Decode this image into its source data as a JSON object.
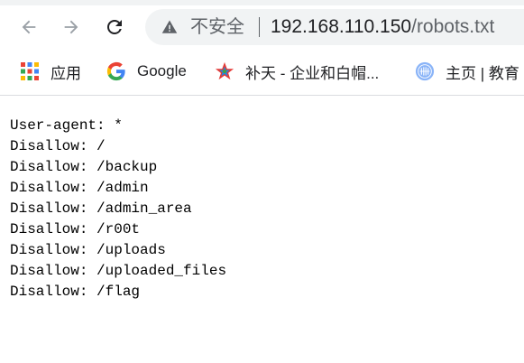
{
  "address_bar": {
    "security_label": "不安全",
    "url_host": "192.168.110.150",
    "url_path": "/robots.txt"
  },
  "bookmarks": [
    {
      "label": "应用",
      "icon": "apps-grid-icon"
    },
    {
      "label": "Google",
      "icon": "google-icon"
    },
    {
      "label": "补天 - 企业和白帽...",
      "icon": "butian-star-icon"
    },
    {
      "label": "主页 | 教育",
      "icon": "globe-icon"
    }
  ],
  "document": {
    "lines": [
      "User-agent: *",
      "Disallow: /",
      "Disallow: /backup",
      "Disallow: /admin",
      "Disallow: /admin_area",
      "Disallow: /r00t",
      "Disallow: /uploads",
      "Disallow: /uploaded_files",
      "Disallow: /flag"
    ]
  },
  "colors": {
    "omnibox_bg": "#f1f3f4",
    "icon_gray": "#5f6368",
    "text": "#202124"
  }
}
